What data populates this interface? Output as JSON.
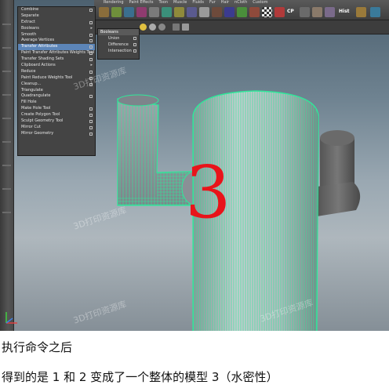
{
  "app": {
    "toolbar_labels": [
      "Rendering",
      "Paint Effects",
      "Toon",
      "Muscle",
      "Fluids",
      "Fur",
      "Hair",
      "nCloth",
      "Custom"
    ],
    "shelf_buttons": {
      "cp": "CP",
      "hist": "Hist"
    }
  },
  "menu": {
    "items": [
      {
        "label": "Combine",
        "opt": true
      },
      {
        "label": "Separate",
        "opt": false
      },
      {
        "label": "Extract",
        "opt": true
      },
      {
        "label": "Booleans",
        "arrow": true
      },
      {
        "label": "Smooth",
        "opt": true
      },
      {
        "label": "Average Vertices",
        "opt": true
      },
      {
        "label": "Transfer Attributes",
        "opt": true,
        "selected": true
      },
      {
        "label": "Paint Transfer Attributes Weights Tool",
        "opt": true
      },
      {
        "label": "Transfer Shading Sets",
        "opt": true
      },
      {
        "label": "Clipboard Actions",
        "arrow": true
      },
      {
        "label": "Reduce",
        "opt": true
      },
      {
        "label": "Paint Reduce Weights Tool",
        "opt": true
      },
      {
        "label": "Cleanup...",
        "opt": true
      },
      {
        "label": "Triangulate",
        "opt": false
      },
      {
        "label": "Quadrangulate",
        "opt": true
      },
      {
        "label": "Fill Hole",
        "opt": false
      },
      {
        "label": "Make Hole Tool",
        "opt": true
      },
      {
        "label": "Create Polygon Tool",
        "opt": true
      },
      {
        "label": "Sculpt Geometry Tool",
        "opt": true
      },
      {
        "label": "Mirror Cut",
        "opt": true
      },
      {
        "label": "Mirror Geometry",
        "opt": true
      }
    ]
  },
  "submenu": {
    "title": "Booleans",
    "items": [
      "Union",
      "Difference",
      "Intersection"
    ]
  },
  "viewport": {
    "overlay_number": "3",
    "watermarks": [
      "3D打印资源库",
      "3D打印资源库",
      "3D打印资源库",
      "3D打印资源库"
    ]
  },
  "captions": {
    "line1": "执行命令之后",
    "line2": "得到的是 1 和 2 变成了一个整体的模型 3（水密性）"
  },
  "colors": {
    "selection_green": "#2fe89a",
    "overlay_red": "#e8141a",
    "menu_highlight": "#5c85b8"
  }
}
